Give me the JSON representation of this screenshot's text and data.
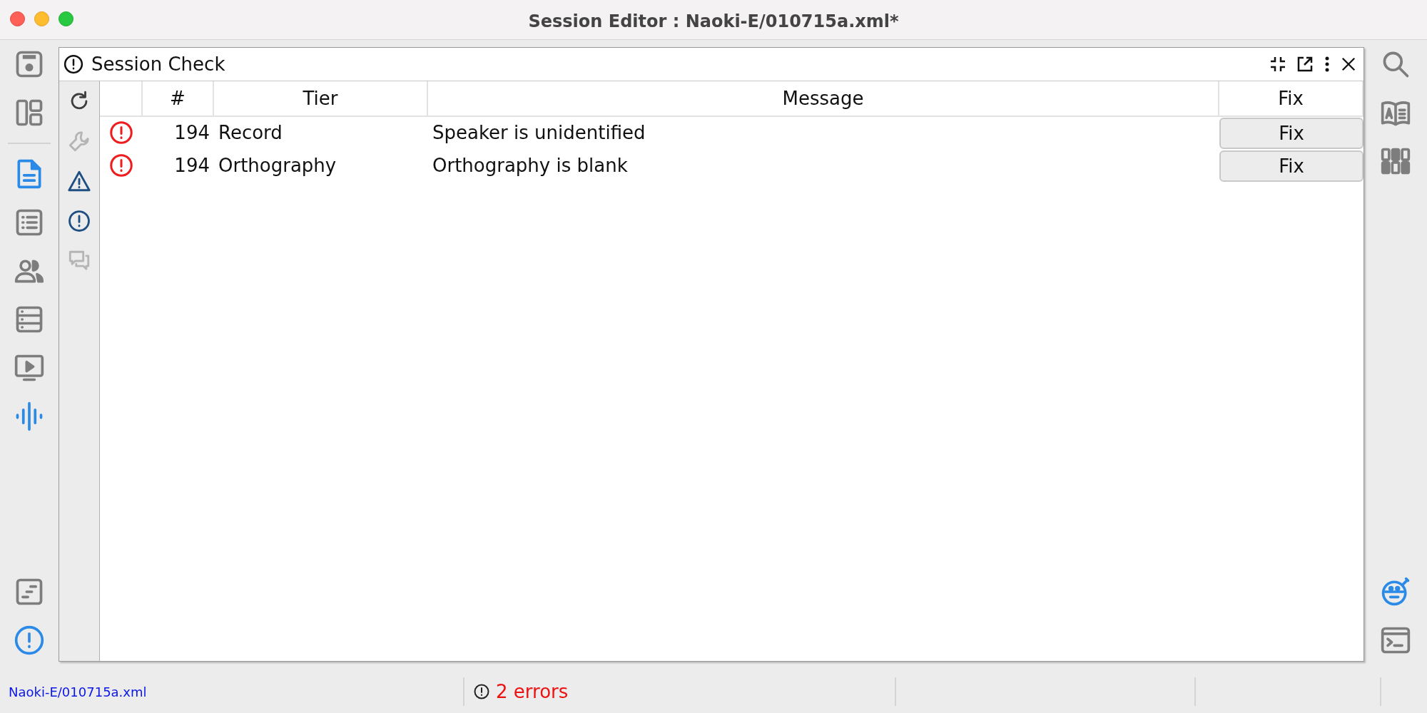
{
  "window": {
    "title": "Session Editor : Naoki-E/010715a.xml*"
  },
  "left_sidebar": {
    "top_items": [
      {
        "kind": "save",
        "active": false
      },
      {
        "kind": "layout",
        "active": false
      }
    ],
    "items": [
      {
        "kind": "document",
        "active": true
      },
      {
        "kind": "list",
        "active": false
      },
      {
        "kind": "people",
        "active": false
      },
      {
        "kind": "records",
        "active": false
      },
      {
        "kind": "media",
        "active": false
      },
      {
        "kind": "waveform",
        "active": true
      }
    ],
    "bottom_items": [
      {
        "kind": "timeline",
        "active": false
      },
      {
        "kind": "alert",
        "active": true
      }
    ]
  },
  "panel": {
    "title": "Session Check",
    "toolbar": [
      {
        "kind": "refresh",
        "disabled": false
      },
      {
        "kind": "wrench",
        "disabled": true
      },
      {
        "kind": "warning",
        "disabled": false
      },
      {
        "kind": "error",
        "disabled": false
      },
      {
        "kind": "comments",
        "disabled": true
      }
    ],
    "columns": [
      "#",
      "Tier",
      "Message",
      "Fix"
    ],
    "rows": [
      {
        "kind": "error",
        "number": "194",
        "tier": "Record",
        "message": "Speaker is unidentified",
        "fix": "Fix"
      },
      {
        "kind": "error",
        "number": "194",
        "tier": "Orthography",
        "message": "Orthography is blank",
        "fix": "Fix"
      }
    ]
  },
  "right_sidebar": {
    "top_items": [
      {
        "kind": "search",
        "active": false
      },
      {
        "kind": "book",
        "active": false
      },
      {
        "kind": "grid",
        "active": false
      }
    ],
    "bottom_items": [
      {
        "kind": "bot",
        "active": true
      },
      {
        "kind": "terminal",
        "active": false
      }
    ]
  },
  "status_bar": {
    "path": "Naoki-E/010715a.xml",
    "errors": "2 errors"
  }
}
